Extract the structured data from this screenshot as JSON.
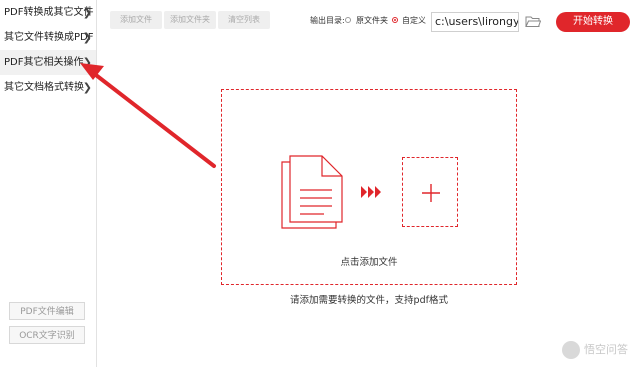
{
  "sidebar": {
    "items": [
      {
        "label": "PDF转换成其它文件"
      },
      {
        "label": "其它文件转换成PDF"
      },
      {
        "label": "PDF其它相关操作"
      },
      {
        "label": "其它文档格式转换"
      }
    ],
    "bottom_buttons": [
      {
        "label": "PDF文件编辑"
      },
      {
        "label": "OCR文字识别"
      }
    ]
  },
  "toolbar": {
    "add_file": "添加文件",
    "add_folder": "添加文件夹",
    "clear_list": "清空列表",
    "output_label": "输出目录:",
    "option_source": "原文件夹",
    "option_custom": "自定义",
    "path_value": "c:\\users\\lirongyu",
    "start_label": "开始转换"
  },
  "dropzone": {
    "text": "点击添加文件",
    "hint": "请添加需要转换的文件，支持pdf格式"
  },
  "watermark": {
    "text": "悟空问答"
  },
  "colors": {
    "accent": "#e0262b"
  }
}
